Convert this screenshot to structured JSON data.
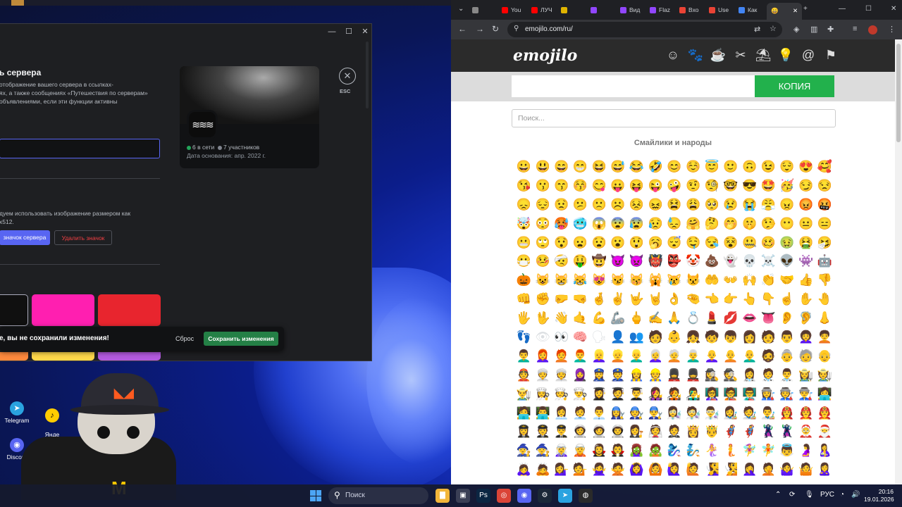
{
  "discord": {
    "section_title": "ь сервера",
    "section_desc": "отображение вашего сервера в ссылках-\nях, а также сообщениях «Путешествия по серверам»\nобъявлениями, если эти функции активны",
    "icon_desc": "дуем использовать изображение размером как\nх512.",
    "upload_label": "значок сервера",
    "delete_label": "Удалить значок",
    "preview": {
      "online": "6 в сети",
      "members": "7 участников",
      "founded": "Дата основания: апр. 2022 г.",
      "icon_text": "≋≋≋"
    },
    "esc_label": "ESC",
    "unsaved_msg": "е, вы не сохранили изменения!",
    "reset_label": "Сброс",
    "save_label": "Сохранить изменения",
    "swatches": [
      "#101010",
      "#ff1fb0",
      "#e8252e"
    ],
    "swatches2": [
      "#ff8a3d",
      "#ffd84a",
      "#b45ae0"
    ]
  },
  "desktop": {
    "icons": [
      {
        "name": "telegram",
        "label": "Telegram",
        "color": "#2aa3e0",
        "glyph": "➤"
      },
      {
        "name": "discord",
        "label": "Discord",
        "color": "#5865f2",
        "glyph": "◉"
      },
      {
        "name": "yandex-music",
        "label": "Янде\nМузы",
        "color": "#ffcc00",
        "glyph": "♪"
      },
      {
        "name": "chrome",
        "label": "",
        "color": "#e74c3c",
        "glyph": "◎"
      }
    ]
  },
  "taskbar": {
    "search_placeholder": "Поиск",
    "lang": "РУС",
    "time": "20:16",
    "date": "19.01.2026",
    "apps": [
      {
        "name": "files",
        "glyph": "▇",
        "color": "#f2b63a"
      },
      {
        "name": "store",
        "glyph": "▣",
        "color": "#3a3f55"
      },
      {
        "name": "photoshop",
        "glyph": "Ps",
        "color": "#0b2642"
      },
      {
        "name": "chrome",
        "glyph": "◎",
        "color": "#db4437"
      },
      {
        "name": "discord",
        "glyph": "◉",
        "color": "#5865f2"
      },
      {
        "name": "steam",
        "glyph": "⚙",
        "color": "#1b2838"
      },
      {
        "name": "telegram",
        "glyph": "➤",
        "color": "#2aa3e0"
      },
      {
        "name": "obs",
        "glyph": "◍",
        "color": "#2a2a2a"
      }
    ]
  },
  "browser": {
    "tabs": [
      {
        "label": "",
        "color": "#888"
      },
      {
        "label": "You",
        "color": "#ff0000"
      },
      {
        "label": "ЛУЧ",
        "color": "#ff0000"
      },
      {
        "label": "",
        "color": "#e0b400"
      },
      {
        "label": "",
        "color": "#9146ff"
      },
      {
        "label": "Вид",
        "color": "#9146ff"
      },
      {
        "label": "Flaz",
        "color": "#9146ff"
      },
      {
        "label": "Вхо",
        "color": "#ea4335"
      },
      {
        "label": "Use",
        "color": "#ea4335"
      },
      {
        "label": "Как",
        "color": "#4285f4"
      }
    ],
    "active_tab_icon": "😄",
    "url": "emojilo.com/ru/",
    "site": {
      "logo": "emojilo",
      "category_icons": [
        "☺",
        "🐾",
        "☕",
        "✂",
        "⛱",
        "💡",
        "@",
        "⚑"
      ],
      "copy_label": "КОПИЯ",
      "search_placeholder": "Поиск...",
      "section_title": "Смайлики и народы",
      "emojis": "😀😃😄😁😆😅😂🤣😊☺️😇🙂🙃😉😌😍🥰😘😗😙😚😋😛😝😜🤪🤨🧐🤓😎🤩🥳😏😒😞😔😟😕🙁☹️😣😖😫😩🥺😢😭😤😠😡🤬🤯😳🥵🥶😱😨😰😥😓🤗🤔🤭🤫🤥😶😐😑😬🙄😯😦😧😮😲🥱😴🤤😪😵🤐🥴🤢🤮🤧😷🤒🤕🤑🤠😈👿👹👺🤡💩👻💀☠️👽👾🤖🎃😺😸😹😻😼😽🙀😿😾🤲👐🙌👏🤝👍👎👊✊🤛🤜🤞✌️🤟🤘👌🤏👈👉👆👇☝️✋🤚🖐🖖👋🤙💪🦾🖕✍️🙏💍💄💋👄👅👂🦻👃👣👁👀🧠🗣👤👥🧑👶👧🧒👦👩🧑👨👩‍🦱🧑‍🦱👨‍🦱👩‍🦰🧑‍🦰👨‍🦰👱‍♀️👱👱‍♂️👩‍🦳🧑‍🦳👨‍🦳👩‍🦲🧑‍🦲👨‍🦲🧔👵🧓👴👲👳‍♀️👳🧕👮‍♀️👮👷‍♀️👷💂‍♀️💂🕵️‍♀️🕵️👩‍⚕️🧑‍⚕️👨‍⚕️👩‍🌾🧑‍🌾👨‍🌾👩‍🍳🧑‍🍳👨‍🍳👩‍🎓🧑‍🎓👨‍🎓👩‍🎤🧑‍🎤👨‍🎤👩‍🏫🧑‍🏫👨‍🏫👩‍🏭🧑‍🏭👨‍🏭👩‍💻🧑‍💻👨‍💻👩‍💼🧑‍💼👨‍💼👩‍🔧🧑‍🔧👨‍🔧👩‍🔬🧑‍🔬👨‍🔬👩‍🎨🧑‍🎨👨‍🎨👩‍🚒🧑‍🚒👨‍🚒👩‍✈️🧑‍✈️👨‍✈️👩‍🚀🧑‍🚀👨‍🚀👩‍⚖️👰🤵👸🤴🦸‍♀️🦸🦹‍♀️🦹🤶🎅🧙‍♀️🧙🧝‍♀️🧝🧛‍♀️🧛🧟‍♀️🧟🧞‍♀️🧞🧜‍♀️🧜🧚‍♀️🧚👼🤰🤱🙇‍♀️🙇💁‍♀️💁🙅‍♀️🙅🙆‍♀️🙆🙋‍♀️🙋🧏‍♀️🧏🤦‍♀️🤦🤷‍♀️🤷🙎‍♀️🙎🙍‍♀️🙍💇‍♀️💇💆‍♀️💆🧖‍♀️🧖💅🤳💃🕺👯‍♀️👯🕴🚶‍♀️🚶🏃‍♀️🏃🧍🧎👫👭👬💑👩‍❤️‍👩👨‍❤️‍👨💏👩‍❤️‍💋‍👩👨‍❤️‍💋‍👨👪👨‍👩‍👧👨‍👩‍👧‍👦👨‍👩‍👦‍👦👨‍👩‍👧‍👧👩‍👩‍👦👩‍👩‍👧👩‍👩‍👧‍👦👩‍👩‍👦‍👦👩‍👩‍👧‍👧👨‍👨‍👦👨‍👨‍👧👨‍👨‍👧‍👦👨‍👨‍👦‍👦👨‍👨‍👧‍👧👩‍👦👩‍👧👩‍👧‍👦👩‍👦‍👦👩‍👧‍👧👨‍👦👨‍👧👨‍👧‍👦👨‍👦‍👦👨‍👧‍👧🧶🧵🧥🥼🦺👚👕👖🩲🩳"
    }
  }
}
